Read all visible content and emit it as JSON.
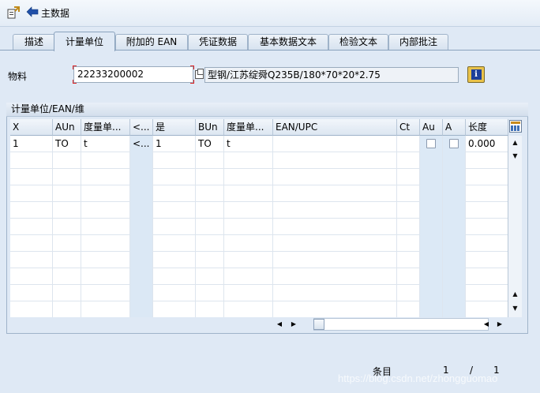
{
  "toolbar": {
    "back_label": "主数据"
  },
  "tabs": [
    {
      "label": "描述"
    },
    {
      "label": "计量单位",
      "active": true
    },
    {
      "label": "附加的 EAN"
    },
    {
      "label": "凭证数据"
    },
    {
      "label": "基本数据文本"
    },
    {
      "label": "检验文本"
    },
    {
      "label": "内部批注"
    }
  ],
  "material": {
    "label": "物料",
    "value": "22233200002",
    "description": "型钢/江苏绽舜Q235B/180*70*20*2.75"
  },
  "group": {
    "title": "计量单位/EAN/维"
  },
  "table": {
    "columns": [
      "X",
      "AUn",
      "度量单...",
      "<...",
      "是",
      "BUn",
      "度量单...",
      "EAN/UPC",
      "Ct",
      "Au",
      "A",
      "长度"
    ],
    "rows": [
      {
        "X": "1",
        "AUn": "TO",
        "uom1": "t",
        "lt": "<...",
        "is": "1",
        "BUn": "TO",
        "uom2": "t",
        "ean": "",
        "ct": "",
        "au": false,
        "a": false,
        "length": "0.000"
      }
    ]
  },
  "footer": {
    "entries_label": "条目",
    "current": "1",
    "separator": "/",
    "total": "1"
  },
  "watermark": "https://blog.csdn.net/zhongguomao"
}
